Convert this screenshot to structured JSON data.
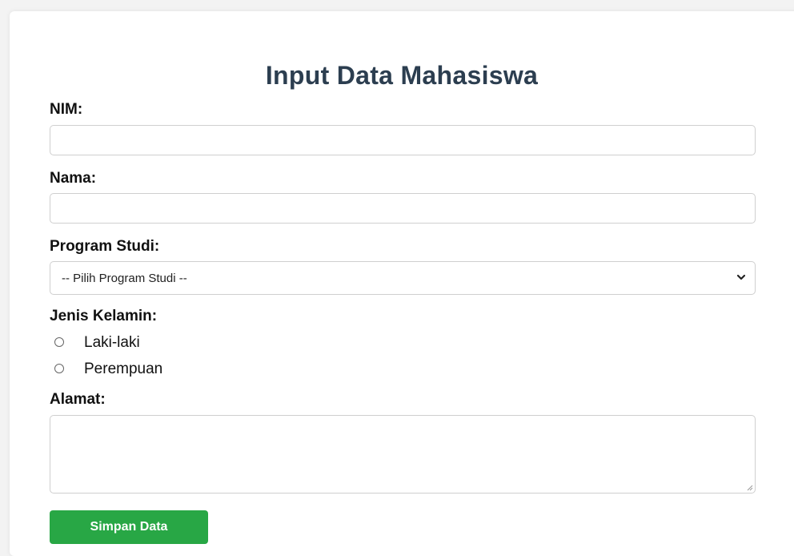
{
  "form": {
    "title": "Input Data Mahasiswa",
    "nim": {
      "label": "NIM:",
      "value": "",
      "placeholder": ""
    },
    "nama": {
      "label": "Nama:",
      "value": "",
      "placeholder": ""
    },
    "program_studi": {
      "label": "Program Studi:",
      "selected": "-- Pilih Program Studi --",
      "icon": "chevron-down-icon"
    },
    "jenis_kelamin": {
      "label": "Jenis Kelamin:",
      "options": [
        {
          "label": "Laki-laki",
          "checked": false
        },
        {
          "label": "Perempuan",
          "checked": false
        }
      ]
    },
    "alamat": {
      "label": "Alamat:",
      "value": "",
      "placeholder": ""
    },
    "submit_label": "Simpan Data"
  },
  "colors": {
    "title": "#2c3e50",
    "button": "#28a745",
    "border": "#cfcfcf",
    "background": "#f3f3f3"
  }
}
